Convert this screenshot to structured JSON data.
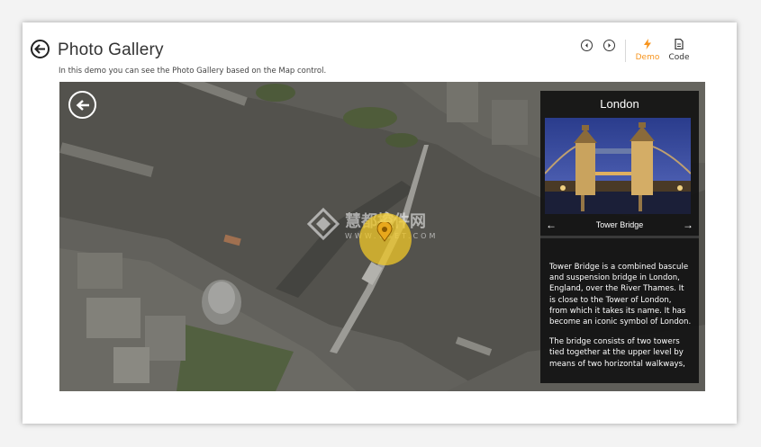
{
  "header": {
    "title": "Photo Gallery",
    "description": "In this demo you can see the Photo Gallery based on the Map control."
  },
  "toolbar": {
    "demo_label": "Demo",
    "code_label": "Code",
    "accent_color": "#f7941d"
  },
  "watermark": {
    "main": "慧都控件网",
    "sub": "WWW.VGET.COM"
  },
  "info_panel": {
    "city": "London",
    "photo_caption": "Tower Bridge",
    "paragraphs": [
      "Tower Bridge is a combined bascule and suspension bridge in London, England, over the River Thames. It is close to the Tower of London, from which it takes its name. It has become an iconic symbol of London.",
      "The bridge consists of two towers tied together at the upper level by means of two horizontal walkways,"
    ]
  },
  "icons": {
    "back": "back-arrow-icon",
    "prev": "chevron-left-icon",
    "next": "chevron-right-icon",
    "demo": "lightning-icon",
    "code": "document-icon",
    "pin": "map-pin-icon"
  }
}
